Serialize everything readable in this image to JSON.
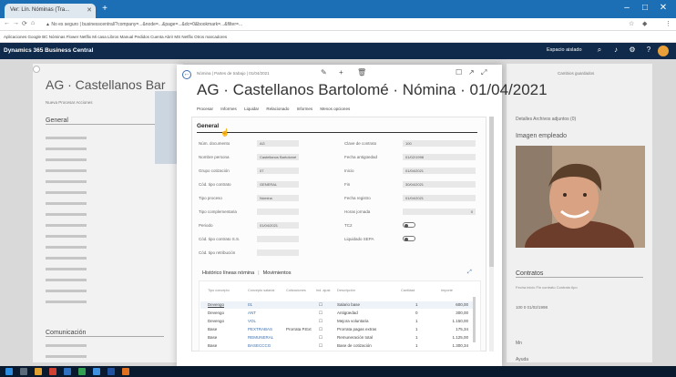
{
  "browser": {
    "tab_title": "Ver: Lín. Nóminas (Tra...",
    "url": "▲ No es seguro | businesscentral/?company=...&node=...&page=...&dc=0&bookmark=...&filter=...",
    "bookmarks": "Aplicaciones  Google  BC Nóminas  Flower  Netflix  Mi casa  Libros  Manual  Pedidos  Cuenta  Abrir  MS  Netflix  Otros marcadores"
  },
  "bc": {
    "brand": "Dynamics 365 Business Central",
    "environment": "Espacio aislado"
  },
  "background": {
    "title": "AG · Castellanos Bar",
    "menu": "Nueva   Procesar   Acciones",
    "group": "General",
    "group2": "Comunicación"
  },
  "factbox": {
    "top": "Cambios guardados",
    "tabs": "Detalles   Archivos adjuntos (0)",
    "image_label": "Imagen empleado",
    "title": "Contratos",
    "cols": "Fecha inicio     Fin contrato     Contrato tipo",
    "vals": "100                      0           01/02/1998",
    "row2": "Mn",
    "row3": "Ayuda"
  },
  "modal": {
    "breadcrumb": "Nómina | Partes de trabajo | 01/04/2021",
    "title": "AG · Castellanos Bartolomé · Nómina · 01/04/2021",
    "actions": [
      "Procesar",
      "Informes",
      "Liquidar",
      "Relacionado",
      "Informes",
      "Menos opciones"
    ],
    "group_label": "General",
    "left_fields": [
      {
        "label": "Núm. documento",
        "value": "AG"
      },
      {
        "label": "Nombre persona",
        "value": "Castellanos Bartolomé"
      },
      {
        "label": "Grupo cotización",
        "value": "07"
      },
      {
        "label": "Cód. tipo contrato",
        "value": "GENERAL"
      },
      {
        "label": "Tipo proceso",
        "value": "Nómina"
      },
      {
        "label": "Tipo complementaria",
        "value": ""
      },
      {
        "label": "Periodo",
        "value": "01/04/2021"
      },
      {
        "label": "Cód. tipo contrato S.S.",
        "value": ""
      },
      {
        "label": "Cód. tipo retribución",
        "value": ""
      }
    ],
    "right_fields": [
      {
        "label": "Clave de contrato",
        "value": "100"
      },
      {
        "label": "Fecha antigüedad",
        "value": "01/02/1998"
      },
      {
        "label": "Inicio",
        "value": "01/04/2021"
      },
      {
        "label": "Fin",
        "value": "30/04/2021"
      },
      {
        "label": "Fecha registro",
        "value": "01/04/2021"
      },
      {
        "label": "Horas jornada",
        "value": "0"
      },
      {
        "label": "TC2",
        "value": ""
      },
      {
        "label": "Liquidado SEPA",
        "value": ""
      }
    ],
    "lines_tabs": [
      "Histórico líneas nómina",
      "Movimientos"
    ],
    "lines_columns": [
      "Tipo concepto",
      "Concepto salarial",
      "Cotizaciones",
      "Ind. ajust.",
      "Descripción",
      "Cantidad",
      "Importe"
    ],
    "lines": [
      {
        "tipo": "Devengo",
        "concepto": "01",
        "cot": "",
        "ind": "☐",
        "desc": "Salario base",
        "cant": "1",
        "importe": "600,00"
      },
      {
        "tipo": "Devengo",
        "concepto": "ANT",
        "cot": "",
        "ind": "☐",
        "desc": "Antigüedad",
        "cant": "0",
        "importe": "300,00"
      },
      {
        "tipo": "Devengo",
        "concepto": "VOL",
        "cot": "",
        "ind": "☐",
        "desc": "Mejora voluntaria",
        "cant": "1",
        "importe": "1.150,00"
      },
      {
        "tipo": "Base",
        "concepto": "PEXTRABAS",
        "cot": "Prorrata P.Ext",
        "ind": "☐",
        "desc": "Prorrata pagas extras",
        "cant": "1",
        "importe": "175,34"
      },
      {
        "tipo": "Base",
        "concepto": "REMUNERAL",
        "cot": "",
        "ind": "☐",
        "desc": "Remuneración total",
        "cant": "1",
        "importe": "1.125,00"
      },
      {
        "tipo": "Base",
        "concepto": "BASECCCG",
        "cot": "",
        "ind": "☐",
        "desc": "Base de cotización",
        "cant": "1",
        "importe": "1.300,34"
      }
    ]
  },
  "colors": {
    "browser_blue": "#1c6fb5",
    "bc_header": "#0f2a4a",
    "link": "#3a6fb0"
  }
}
